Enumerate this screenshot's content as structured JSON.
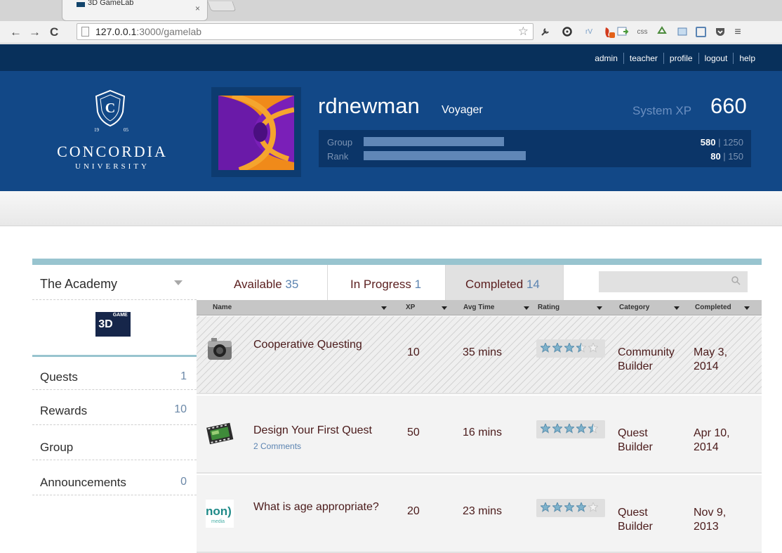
{
  "browser": {
    "tab_title": "3D GameLab",
    "tab_close": "×",
    "url_host": "127.0.0.1",
    "url_rest": ":3000/gamelab",
    "back": "←",
    "forward": "→",
    "reload": "C",
    "bookmark_star": "☆"
  },
  "topnav": {
    "links": [
      "admin",
      "teacher",
      "profile",
      "logout",
      "help"
    ]
  },
  "logo": {
    "wordmark": "CONCORDIA",
    "subtitle": "UNIVERSITY",
    "letter": "C",
    "year_left": "19",
    "year_right": "05"
  },
  "profile": {
    "username": "rdnewman",
    "rank_title": "Voyager",
    "system_xp_label": "System XP",
    "system_xp": "660",
    "bars": [
      {
        "label": "Group",
        "value": "580",
        "max": "1250",
        "fraction": 0.464
      },
      {
        "label": "Rank",
        "value": "80",
        "max": "150",
        "fraction": 0.533
      }
    ]
  },
  "sidebar": {
    "academy": "The Academy",
    "lab_logo_main": "3D",
    "lab_logo_small": "GAME LAB",
    "items": [
      {
        "label": "Quests",
        "count": "1"
      },
      {
        "label": "Rewards",
        "count": "10"
      },
      {
        "label": "Group",
        "count": ""
      },
      {
        "label": "Announcements",
        "count": "0"
      }
    ]
  },
  "tabs": [
    {
      "label": "Available",
      "count": "35"
    },
    {
      "label": "In Progress",
      "count": "1"
    },
    {
      "label": "Completed",
      "count": "14"
    }
  ],
  "columns": [
    "Name",
    "XP",
    "Avg Time",
    "Rating",
    "Category",
    "Completed"
  ],
  "quests": [
    {
      "name": "Cooperative Questing",
      "comments": "",
      "xp": "10",
      "avg_time": "35 mins",
      "rating": 3.5,
      "category_line1": "Community",
      "category_line2": "Builder",
      "completed_line1": "May 3,",
      "completed_line2": "2014",
      "icon": "camera-icon"
    },
    {
      "name": "Design Your First Quest",
      "comments": "2 Comments",
      "xp": "50",
      "avg_time": "16 mins",
      "rating": 4.5,
      "category_line1": "Quest",
      "category_line2": "Builder",
      "completed_line1": "Apr 10,",
      "completed_line2": "2014",
      "icon": "film-icon"
    },
    {
      "name": "What is age appropriate?",
      "comments": "",
      "xp": "20",
      "avg_time": "23 mins",
      "rating": 4,
      "category_line1": "Quest",
      "category_line2": "Builder",
      "completed_line1": "Nov 9,",
      "completed_line2": "2013",
      "icon": "nonsmedia-logo"
    }
  ]
}
